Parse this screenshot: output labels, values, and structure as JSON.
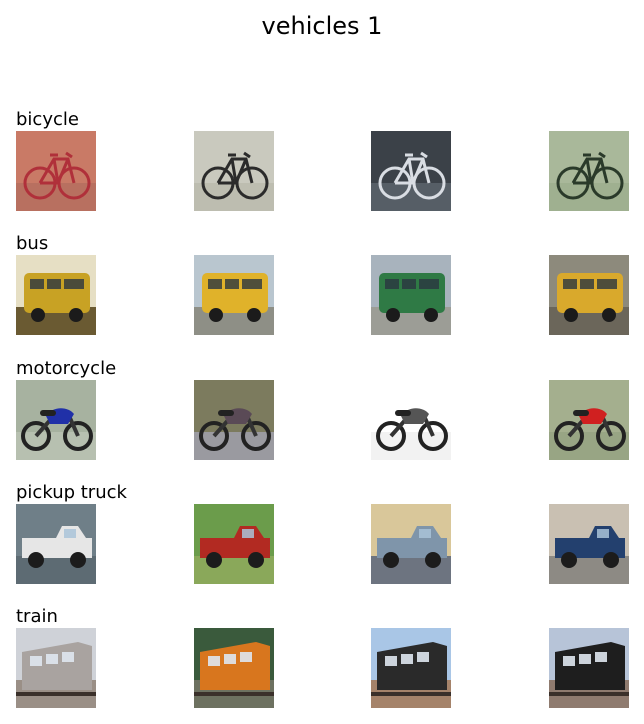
{
  "title": "vehicles 1",
  "rows": [
    {
      "label": "bicycle",
      "images": [
        {
          "subject": "bicycle-icon",
          "bg": "#c97a66",
          "ground": "#b87060",
          "fg": "#b0303a"
        },
        {
          "subject": "bicycle-icon",
          "bg": "#c9c9be",
          "ground": "#bdbdb0",
          "fg": "#2b2b2b"
        },
        {
          "subject": "bicycle-icon",
          "bg": "#3b4148",
          "ground": "#565e66",
          "fg": "#d9dde3"
        },
        {
          "subject": "bicycle-icon",
          "bg": "#a9b89a",
          "ground": "#9fb090",
          "fg": "#2a3a2a"
        }
      ]
    },
    {
      "label": "bus",
      "images": [
        {
          "subject": "bus-icon",
          "bg": "#e6dfc4",
          "ground": "#6a5a32",
          "fg": "#c8a224"
        },
        {
          "subject": "bus-icon",
          "bg": "#b9c6cf",
          "ground": "#8e8f86",
          "fg": "#e0b22a"
        },
        {
          "subject": "bus-icon",
          "bg": "#a8b3bd",
          "ground": "#9c9d96",
          "fg": "#2f7a45"
        },
        {
          "subject": "bus-icon",
          "bg": "#8d8a7c",
          "ground": "#6b665a",
          "fg": "#d9a92c"
        }
      ]
    },
    {
      "label": "motorcycle",
      "images": [
        {
          "subject": "motorcycle-icon",
          "bg": "#a7b2a0",
          "ground": "#b7c0b0",
          "fg": "#2030a8"
        },
        {
          "subject": "motorcycle-icon",
          "bg": "#7c7b5e",
          "ground": "#9a9aa0",
          "fg": "#5a4a56"
        },
        {
          "subject": "motorcycle-icon",
          "bg": "#ffffff",
          "ground": "#f2f2f2",
          "fg": "#555555"
        },
        {
          "subject": "motorcycle-icon",
          "bg": "#a4af8e",
          "ground": "#98a584",
          "fg": "#d02020"
        }
      ]
    },
    {
      "label": "pickup truck",
      "images": [
        {
          "subject": "pickup-truck-icon",
          "bg": "#6f7f88",
          "ground": "#5d6b73",
          "fg": "#e6e6e6"
        },
        {
          "subject": "pickup-truck-icon",
          "bg": "#6b9c4b",
          "ground": "#8aa85a",
          "fg": "#b22a22"
        },
        {
          "subject": "pickup-truck-icon",
          "bg": "#d9c79a",
          "ground": "#6d7480",
          "fg": "#7f95aa"
        },
        {
          "subject": "pickup-truck-icon",
          "bg": "#c9c0b2",
          "ground": "#8d8a84",
          "fg": "#23406e"
        }
      ]
    },
    {
      "label": "train",
      "images": [
        {
          "subject": "train-icon",
          "bg": "#cfd2d8",
          "ground": "#9a8f86",
          "fg": "#a9a3a0"
        },
        {
          "subject": "train-icon",
          "bg": "#3a5a3c",
          "ground": "#6d7160",
          "fg": "#d8761e"
        },
        {
          "subject": "train-icon",
          "bg": "#a9c6e6",
          "ground": "#a5836a",
          "fg": "#2a2a2a"
        },
        {
          "subject": "train-icon",
          "bg": "#b7c4d8",
          "ground": "#8f7b6f",
          "fg": "#1e1e1e"
        }
      ]
    }
  ]
}
